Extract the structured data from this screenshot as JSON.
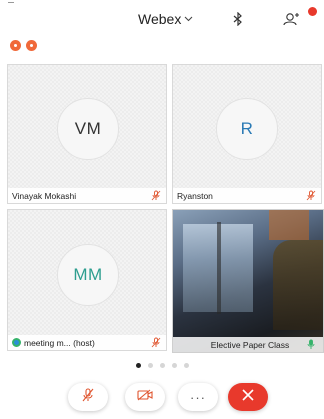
{
  "header": {
    "title": "Webex",
    "title_dropdown_icon": "chevron-down-icon",
    "bluetooth_icon": "bluetooth-icon",
    "participants_icon": "participants-icon"
  },
  "participants": [
    {
      "initials": "VM",
      "name": "Vinayak Mokashi",
      "muted": true,
      "avatar_color": "#333333"
    },
    {
      "initials": "R",
      "name": "Ryanston",
      "muted": true,
      "avatar_color": "#2a7ab5"
    },
    {
      "initials": "MM",
      "name": "meeting m... (host)",
      "muted": true,
      "avatar_color": "#2d9e8f"
    },
    {
      "initials": "",
      "name": "Elective Paper Class",
      "muted": false,
      "video": true
    }
  ],
  "pager": {
    "total_pages": 5,
    "current_page": 1
  },
  "controls": {
    "mute_icon": "mic-muted-icon",
    "video_icon": "video-off-icon",
    "more_label": "···",
    "end_icon": "close-icon"
  },
  "colors": {
    "accent_red": "#e8392c",
    "muted_mic": "#e0552f",
    "unmuted_mic": "#35b36a"
  }
}
